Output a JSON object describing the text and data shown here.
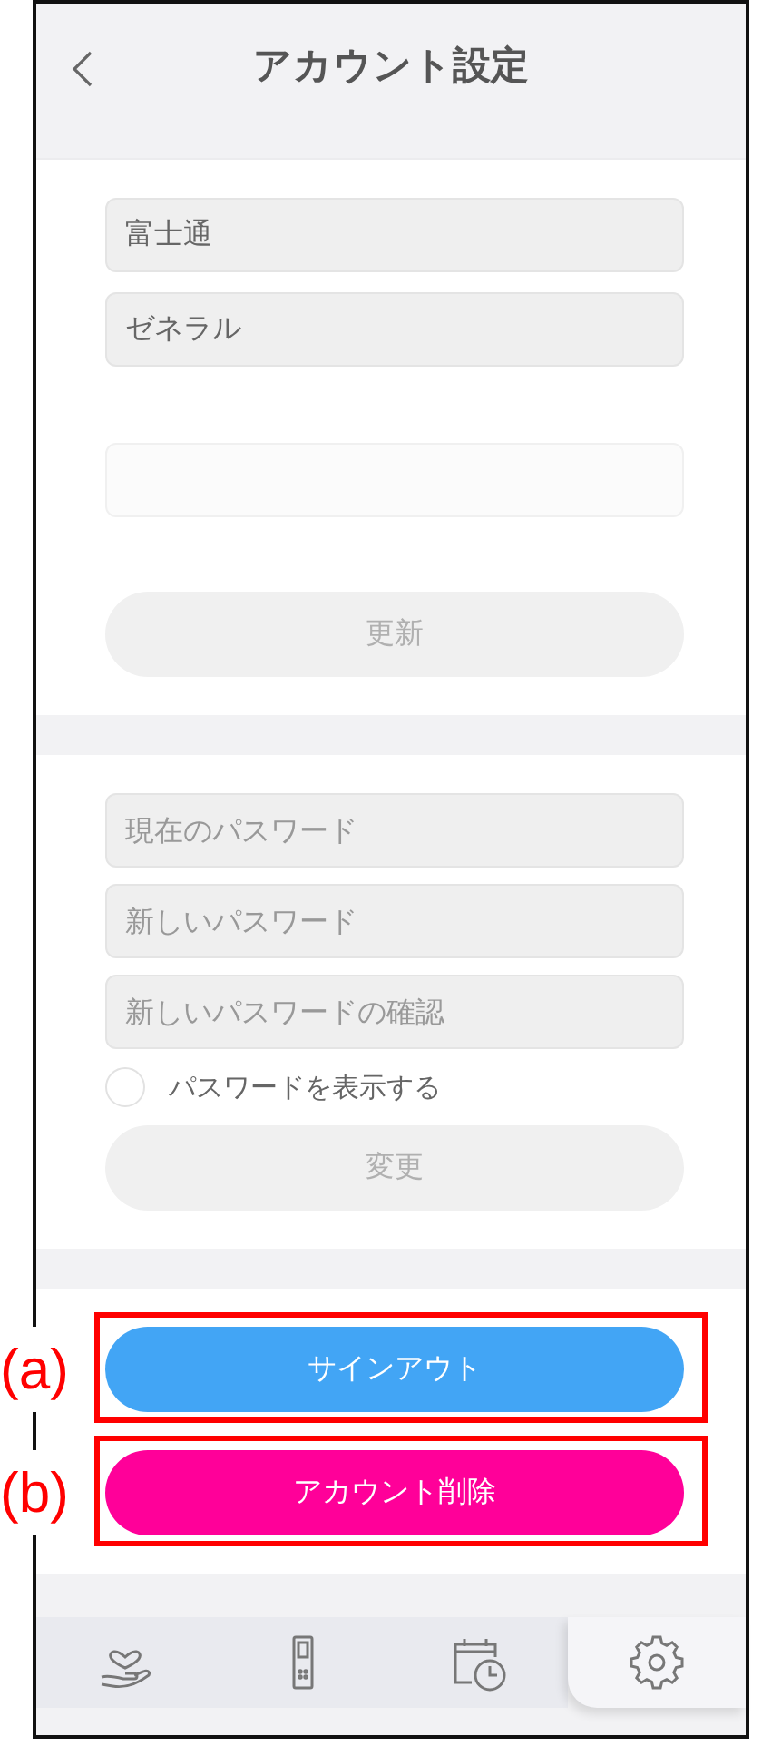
{
  "header": {
    "title": "アカウント設定"
  },
  "profile": {
    "fields": [
      {
        "value": "富士通",
        "disabled": false
      },
      {
        "value": "ゼネラル",
        "disabled": false
      },
      {
        "disabled": true
      }
    ],
    "button": {
      "label": "更新",
      "disabled": true
    }
  },
  "password": {
    "fields": [
      {
        "placeholder": "現在のパスワード"
      },
      {
        "placeholder": "新しいパスワード"
      },
      {
        "placeholder": "新しいパスワードの確認"
      }
    ],
    "show_password": {
      "label": "パスワードを表示する",
      "checked": false
    },
    "button": {
      "label": "変更",
      "disabled": true
    }
  },
  "actions": [
    {
      "label": "サインアウト",
      "color": "#42a5f5",
      "annotation": "(a)"
    },
    {
      "label": "アカウント削除",
      "color": "#ff0099",
      "annotation": "(b)"
    }
  ],
  "tabs": [
    {
      "kind": "care",
      "selected": false
    },
    {
      "kind": "remote",
      "selected": false
    },
    {
      "kind": "schedule",
      "selected": false
    },
    {
      "kind": "settings",
      "selected": true
    }
  ]
}
